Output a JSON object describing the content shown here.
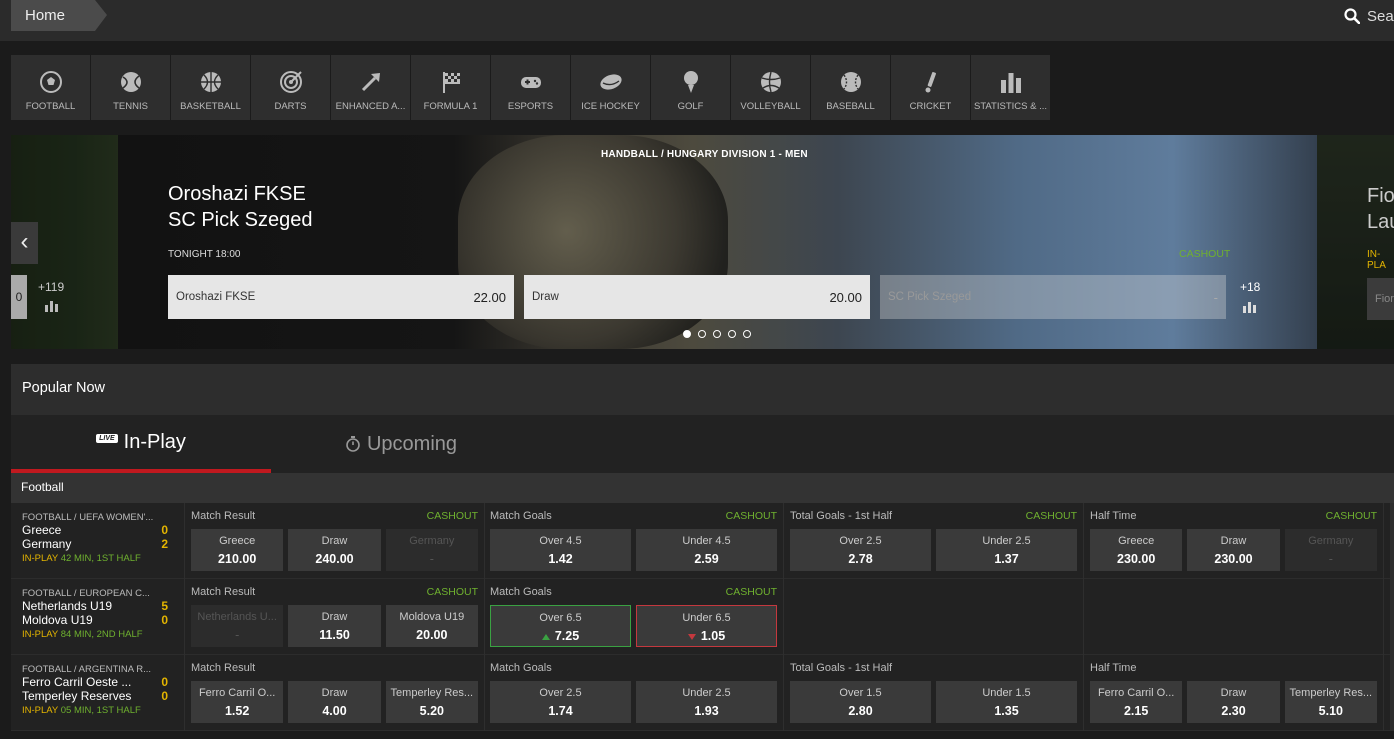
{
  "topbar": {
    "home": "Home",
    "search": "Sear"
  },
  "sports": [
    {
      "label": "FOOTBALL",
      "icon": "football-icon"
    },
    {
      "label": "TENNIS",
      "icon": "tennis-icon"
    },
    {
      "label": "BASKETBALL",
      "icon": "basketball-icon"
    },
    {
      "label": "DARTS",
      "icon": "darts-icon"
    },
    {
      "label": "ENHANCED A...",
      "icon": "enhanced-arrow-icon"
    },
    {
      "label": "FORMULA 1",
      "icon": "checkered-flag-icon"
    },
    {
      "label": "ESPORTS",
      "icon": "gamepad-icon"
    },
    {
      "label": "ICE HOCKEY",
      "icon": "puck-icon"
    },
    {
      "label": "GOLF",
      "icon": "golf-icon"
    },
    {
      "label": "VOLLEYBALL",
      "icon": "volleyball-icon"
    },
    {
      "label": "BASEBALL",
      "icon": "baseball-icon"
    },
    {
      "label": "CRICKET",
      "icon": "cricket-icon"
    },
    {
      "label": "STATISTICS & ...",
      "icon": "statistics-icon"
    }
  ],
  "carousel": {
    "league": "HANDBALL / HUNGARY DIVISION 1 - MEN",
    "team1": "Oroshazi FKSE",
    "team2": "SC Pick Szeged",
    "when": "TONIGHT 18:00",
    "cashout": "CASHOUT",
    "odds": [
      {
        "label": "Oroshazi FKSE",
        "value": "22.00"
      },
      {
        "label": "Draw",
        "value": "20.00"
      },
      {
        "label": "SC Pick Szeged",
        "value": "-"
      }
    ],
    "more": "+18",
    "left_value": "0",
    "left_more": "+119",
    "right_team1": "Fio",
    "right_team2": "Lau",
    "right_status": "IN-PLA",
    "right_box": "Fior",
    "dots": 5,
    "active_dot": 0
  },
  "popular": {
    "title": "Popular Now"
  },
  "tabs": {
    "inplay": "In-Play",
    "live_badge": "LIVE",
    "upcoming": "Upcoming"
  },
  "section": "Football",
  "colors": {
    "cashout": "#6fb12f",
    "score": "#e4b500",
    "active_tab": "#c0191f"
  },
  "events": [
    {
      "league": "FOOTBALL / UEFA WOMEN'...",
      "home": "Greece",
      "home_score": "0",
      "away": "Germany",
      "away_score": "2",
      "status_ip": "IN-PLAY",
      "status": "42 MIN, 1ST HALF",
      "markets": [
        {
          "name": "Match Result",
          "cashout": "CASHOUT",
          "outcomes": [
            {
              "label": "Greece",
              "value": "210.00"
            },
            {
              "label": "Draw",
              "value": "240.00"
            },
            {
              "label": "Germany",
              "value": "-",
              "disabled": true
            }
          ]
        },
        {
          "name": "Match Goals",
          "cashout": "CASHOUT",
          "outcomes": [
            {
              "label": "Over 4.5",
              "value": "1.42"
            },
            {
              "label": "Under 4.5",
              "value": "2.59"
            }
          ]
        },
        {
          "name": "Total Goals - 1st Half",
          "cashout": "CASHOUT",
          "outcomes": [
            {
              "label": "Over 2.5",
              "value": "2.78"
            },
            {
              "label": "Under 2.5",
              "value": "1.37"
            }
          ]
        },
        {
          "name": "Half Time",
          "cashout": "CASHOUT",
          "outcomes": [
            {
              "label": "Greece",
              "value": "230.00"
            },
            {
              "label": "Draw",
              "value": "230.00"
            },
            {
              "label": "Germany",
              "value": "-",
              "disabled": true
            }
          ]
        }
      ]
    },
    {
      "league": "FOOTBALL / EUROPEAN C...",
      "home": "Netherlands U19",
      "home_score": "5",
      "away": "Moldova U19",
      "away_score": "0",
      "status_ip": "IN-PLAY",
      "status": "84 MIN, 2ND HALF",
      "markets": [
        {
          "name": "Match Result",
          "cashout": "CASHOUT",
          "outcomes": [
            {
              "label": "Netherlands U...",
              "value": "-",
              "disabled": true
            },
            {
              "label": "Draw",
              "value": "11.50"
            },
            {
              "label": "Moldova U19",
              "value": "20.00"
            }
          ]
        },
        {
          "name": "Match Goals",
          "cashout": "CASHOUT",
          "outcomes": [
            {
              "label": "Over 6.5",
              "value": "7.25",
              "move": "up"
            },
            {
              "label": "Under 6.5",
              "value": "1.05",
              "move": "down"
            }
          ]
        }
      ]
    },
    {
      "league": "FOOTBALL / ARGENTINA R...",
      "home": "Ferro Carril Oeste ...",
      "home_score": "0",
      "away": "Temperley Reserves",
      "away_score": "0",
      "status_ip": "IN-PLAY",
      "status": "05 MIN, 1ST HALF",
      "markets": [
        {
          "name": "Match Result",
          "cashout": "",
          "outcomes": [
            {
              "label": "Ferro Carril O...",
              "value": "1.52"
            },
            {
              "label": "Draw",
              "value": "4.00"
            },
            {
              "label": "Temperley Res...",
              "value": "5.20"
            }
          ]
        },
        {
          "name": "Match Goals",
          "cashout": "",
          "outcomes": [
            {
              "label": "Over 2.5",
              "value": "1.74"
            },
            {
              "label": "Under 2.5",
              "value": "1.93"
            }
          ]
        },
        {
          "name": "Total Goals - 1st Half",
          "cashout": "",
          "outcomes": [
            {
              "label": "Over 1.5",
              "value": "2.80"
            },
            {
              "label": "Under 1.5",
              "value": "1.35"
            }
          ]
        },
        {
          "name": "Half Time",
          "cashout": "",
          "outcomes": [
            {
              "label": "Ferro Carril O...",
              "value": "2.15"
            },
            {
              "label": "Draw",
              "value": "2.30"
            },
            {
              "label": "Temperley Res...",
              "value": "5.10"
            }
          ]
        }
      ]
    }
  ]
}
